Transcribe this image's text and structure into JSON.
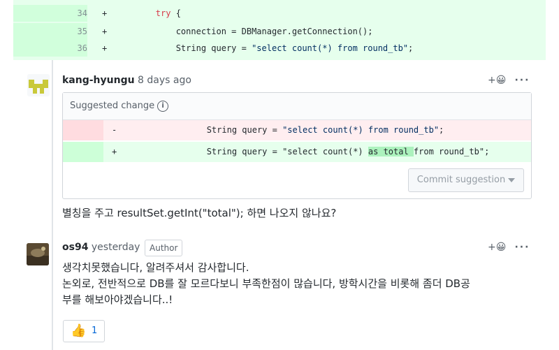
{
  "code_context": {
    "lines": [
      {
        "num": "34",
        "sign": "+",
        "indent": "        ",
        "keyword": "try",
        "rest": " {"
      },
      {
        "num": "35",
        "sign": "+",
        "indent": "            ",
        "text": "connection = DBManager.getConnection();"
      },
      {
        "num": "36",
        "sign": "+",
        "indent": "            ",
        "pre": "String query = ",
        "string": "\"select count(*) from round_tb\"",
        "post": ";"
      }
    ]
  },
  "comments": [
    {
      "author": "kang-hyungu",
      "time": "8 days ago",
      "suggestion": {
        "title": "Suggested change",
        "deleted": {
          "sign": "-",
          "pre": "            String query = ",
          "string": "\"select count(*) from round_tb\"",
          "post": ";"
        },
        "added": {
          "sign": "+",
          "pre": "            String query = \"select count(*) ",
          "highlight": "as total ",
          "post": "from round_tb\";"
        },
        "commit_label": "Commit suggestion"
      },
      "body": "별칭을 주고 resultSet.getInt(\"total\"); 하면 나오지 않나요?"
    },
    {
      "author": "os94",
      "time": "yesterday",
      "badge": "Author",
      "body_lines": [
        "생각치못했습니다, 알려주셔서 감사합니다.",
        "논외로, 전반적으로 DB를 잘 모르다보니 부족한점이 많습니다, 방학시간을 비롯해 좀더 DB공",
        "부를 해보아야겠습니다..!"
      ],
      "reaction": {
        "emoji": "👍",
        "count": "1"
      }
    }
  ],
  "actions": {
    "react": "+😀",
    "more": "···"
  }
}
